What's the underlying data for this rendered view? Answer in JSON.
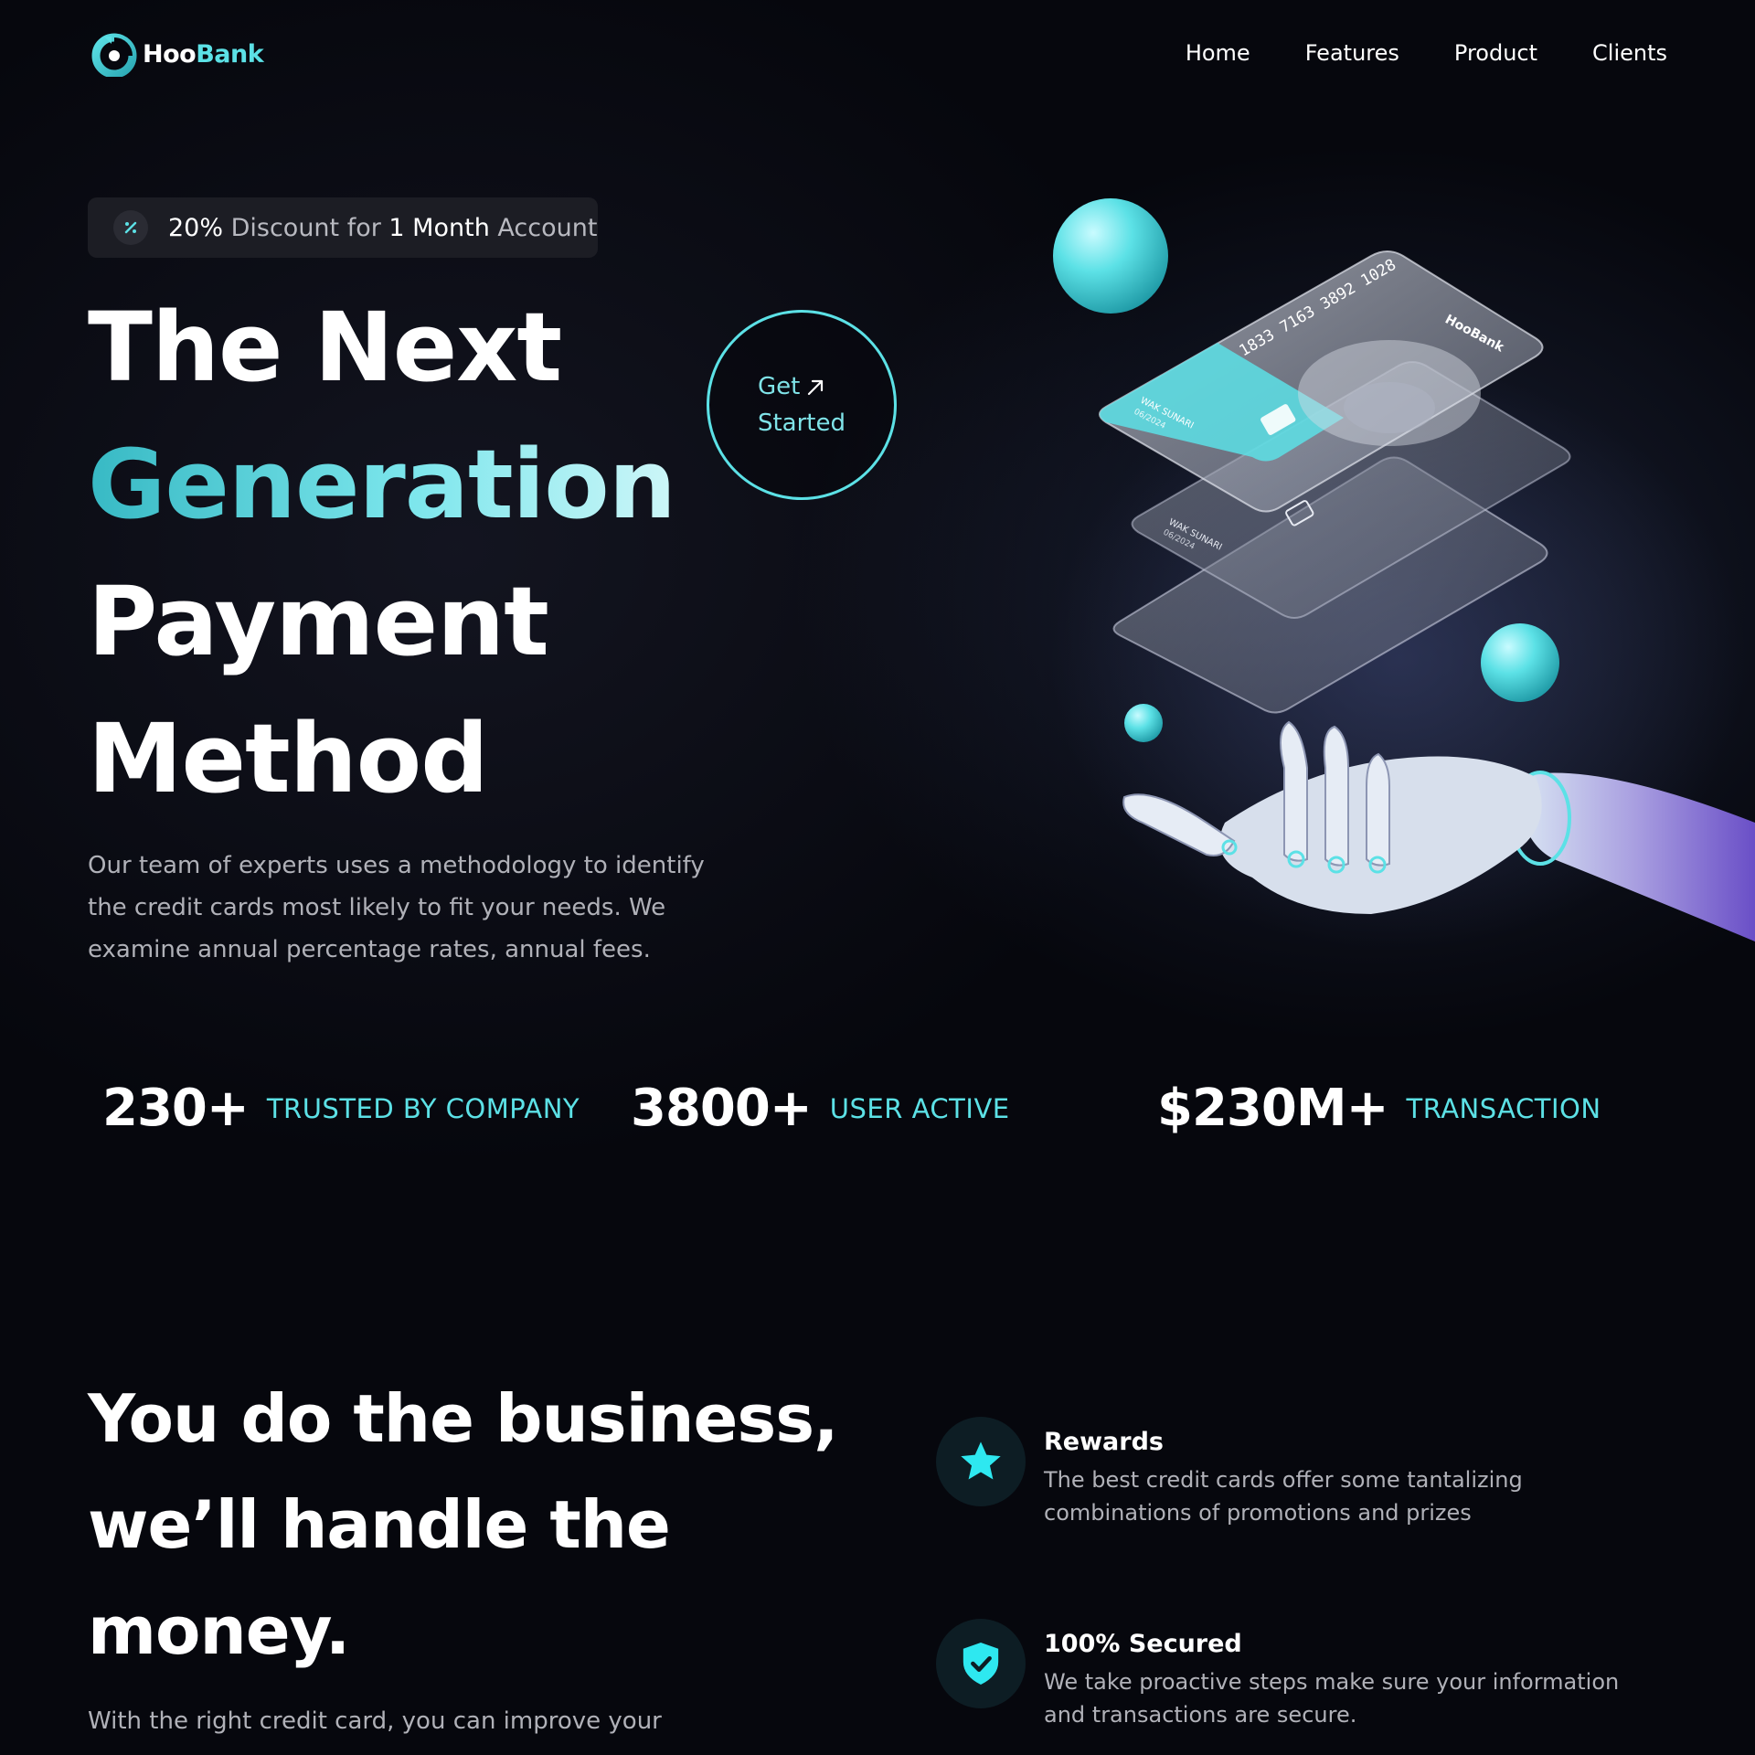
{
  "brand": {
    "name_part1": "Hoo",
    "name_part2": "Bank",
    "accent_color": "#5ce1e6"
  },
  "nav": {
    "items": [
      "Home",
      "Features",
      "Product",
      "Clients"
    ]
  },
  "promo": {
    "discount": "20%",
    "text1": " Discount for ",
    "months": "1 Month",
    "text2": " Account",
    "icon": "discount-icon"
  },
  "hero": {
    "title_line1": "The Next",
    "title_line2": "Generation",
    "title_line3": "Payment",
    "title_line4": "Method",
    "cta_line1": "Get",
    "cta_line2": "Started",
    "description": "Our team of experts uses a methodology to identify the credit cards most likely to fit your needs. We examine annual percentage rates, annual fees."
  },
  "cards": {
    "number": "1833 7163 3892 1028",
    "holder": "WAK SUNARI",
    "expiry": "06/2024",
    "card_brand": "HooBank"
  },
  "stats": [
    {
      "value": "230+",
      "label": "TRUSTED BY COMPANY"
    },
    {
      "value": "3800+",
      "label": "USER ACTIVE"
    },
    {
      "value": "$230M+",
      "label": "TRANSACTION"
    }
  ],
  "business": {
    "title_line1": "You do the business,",
    "title_line2": "we’ll handle the",
    "title_line3": "money.",
    "description": "With the right credit card, you can improve your"
  },
  "features": [
    {
      "icon": "star-icon",
      "title": "Rewards",
      "text": "The best credit cards offer some tantalizing combinations of promotions and prizes"
    },
    {
      "icon": "shield-icon",
      "title": "100% Secured",
      "text": "We take proactive steps make sure your information and transactions are secure."
    }
  ]
}
